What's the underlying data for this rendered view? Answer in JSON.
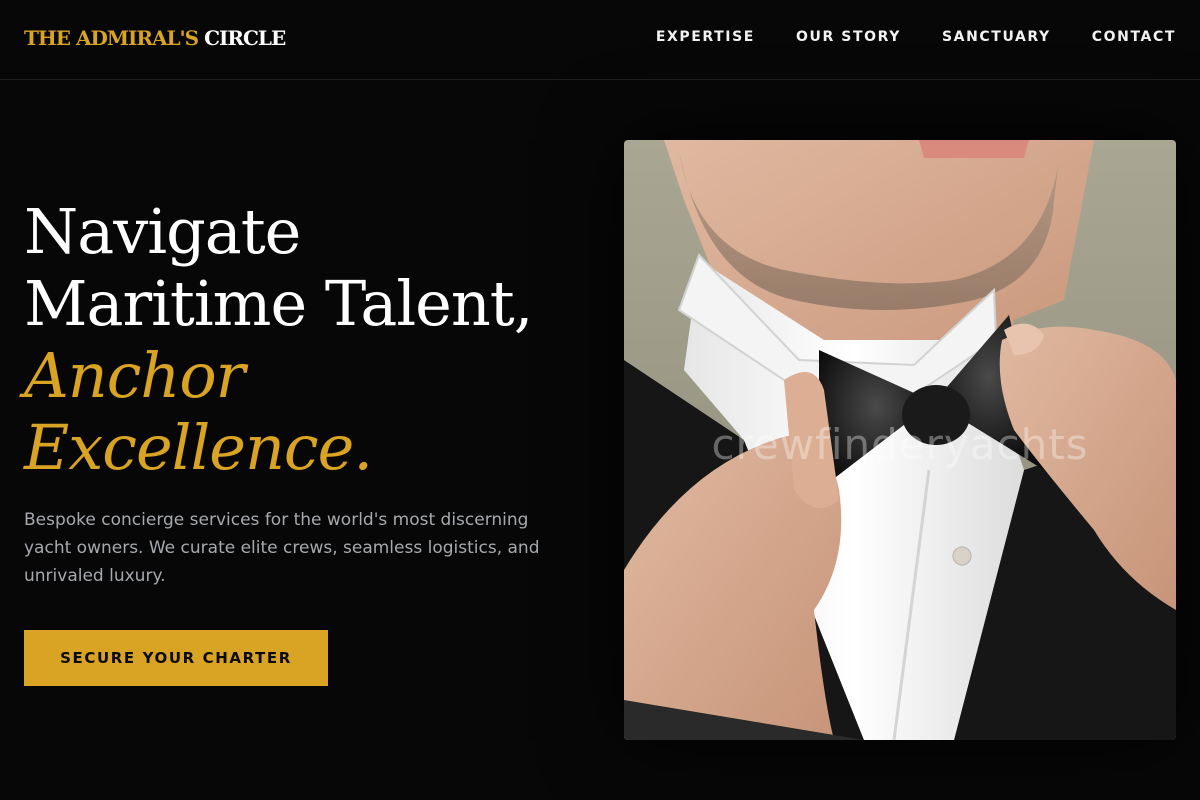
{
  "brand": {
    "logo_gold": "THE ADMIRAL'S",
    "logo_white": "CIRCLE",
    "gold_color": "#d9a323"
  },
  "nav": {
    "items": [
      {
        "label": "EXPERTISE"
      },
      {
        "label": "OUR STORY"
      },
      {
        "label": "SANCTUARY"
      },
      {
        "label": "CONTACT"
      }
    ]
  },
  "hero": {
    "title_line1": "Navigate",
    "title_line2": "Maritime Talent,",
    "title_accent1": "Anchor",
    "title_accent2": "Excellence.",
    "description": "Bespoke concierge services for the world's most discerning yacht owners. We curate elite crews, seamless logistics, and unrivaled luxury.",
    "cta_label": "SECURE YOUR CHARTER",
    "image_watermark": "crewfinderyachts"
  }
}
